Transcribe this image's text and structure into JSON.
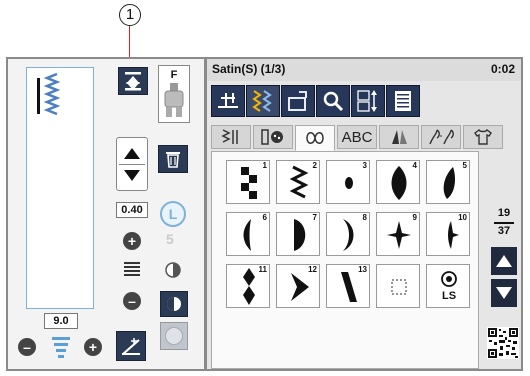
{
  "callout": {
    "number": "1"
  },
  "left": {
    "foot_letter": "F",
    "width_value": "0.40",
    "length_value": "9.0",
    "icons": {
      "memorize": "memorize-icon",
      "up": "arrow-up-icon",
      "down": "arrow-down-icon",
      "delete": "trash-icon",
      "lock": "lock-icon",
      "plus": "plus-icon",
      "minus": "minus-icon"
    }
  },
  "right": {
    "title": "Satin(S) (1/3)",
    "time": "0:02",
    "tabs": [
      "ABC"
    ],
    "stitches": [
      {
        "num": "1"
      },
      {
        "num": "2"
      },
      {
        "num": "3"
      },
      {
        "num": "4"
      },
      {
        "num": "5"
      },
      {
        "num": "6"
      },
      {
        "num": "7"
      },
      {
        "num": "8"
      },
      {
        "num": "9"
      },
      {
        "num": "10"
      },
      {
        "num": "11"
      },
      {
        "num": "12"
      },
      {
        "num": "13"
      }
    ],
    "ls_label": "LS",
    "page_current": "19",
    "page_total": "37"
  },
  "colors": {
    "dark_button": "#2b3a55",
    "frame": "#8a8a8a",
    "preview_border": "#7fb2d9",
    "callout_line": "#d2232a"
  }
}
